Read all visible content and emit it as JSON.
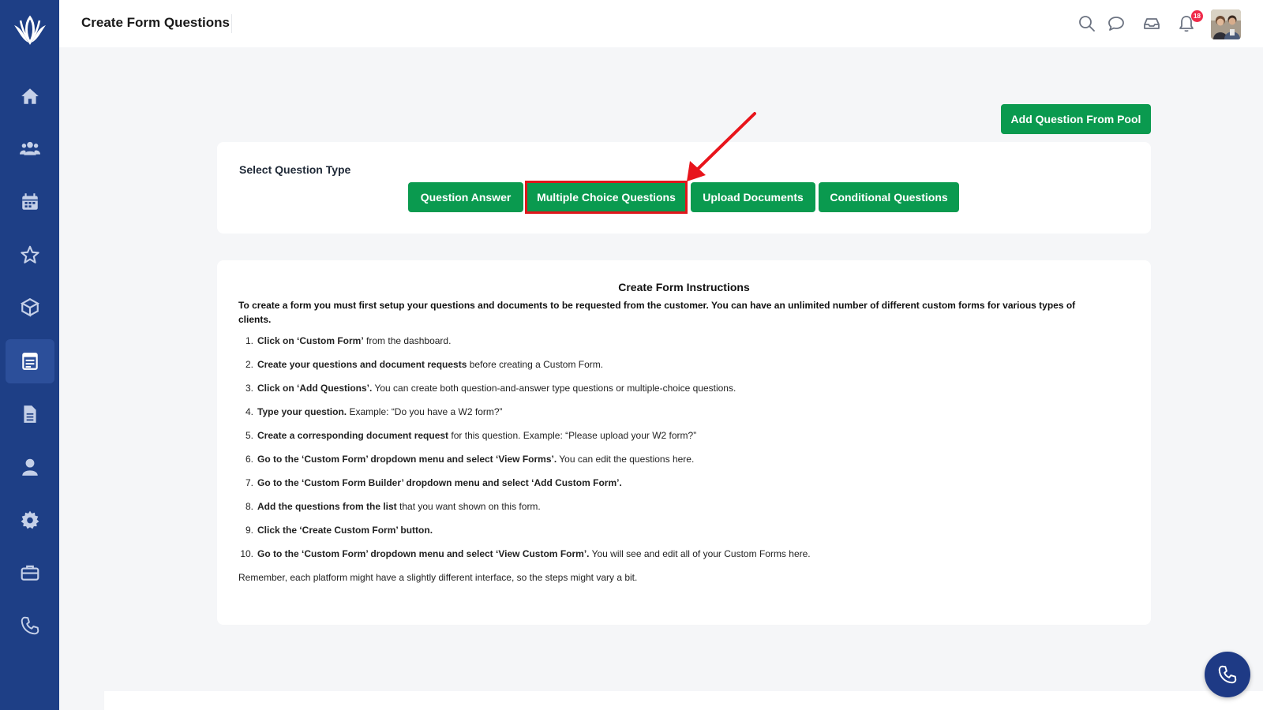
{
  "header": {
    "title": "Create Form Questions",
    "notification_count": "18"
  },
  "sidebar": {
    "items": [
      {
        "icon": "home-icon"
      },
      {
        "icon": "users-icon"
      },
      {
        "icon": "calendar-icon"
      },
      {
        "icon": "star-icon"
      },
      {
        "icon": "box-icon"
      },
      {
        "icon": "form-icon",
        "active": true
      },
      {
        "icon": "document-icon"
      },
      {
        "icon": "user-icon"
      },
      {
        "icon": "gear-icon"
      },
      {
        "icon": "briefcase-icon"
      },
      {
        "icon": "phone-icon"
      }
    ]
  },
  "actions": {
    "add_pool_label": "Add Question From Pool"
  },
  "question_type": {
    "label": "Select Question Type",
    "buttons": [
      "Question Answer",
      "Multiple Choice Questions",
      "Upload Documents",
      "Conditional Questions"
    ],
    "highlighted": "Multiple Choice Questions"
  },
  "instructions": {
    "title": "Create Form Instructions",
    "intro": "To create a form you must first setup your questions and documents to be requested from the customer. You can have an unlimited number of different custom forms for various types of clients.",
    "steps": [
      {
        "num": "1.",
        "bold": "Click on ‘Custom Form’",
        "rest": " from the dashboard."
      },
      {
        "num": "2.",
        "bold": "Create your questions and document requests",
        "rest": " before creating a Custom Form."
      },
      {
        "num": "3.",
        "bold": "Click on ‘Add Questions’.",
        "rest": " You can create both question-and-answer type questions or multiple-choice questions."
      },
      {
        "num": "4.",
        "bold": "Type your question.",
        "rest": " Example: “Do you have a W2 form?”"
      },
      {
        "num": "5.",
        "bold": "Create a corresponding document request",
        "rest": " for this question. Example: “Please upload your W2 form?”"
      },
      {
        "num": "6.",
        "bold": "Go to the ‘Custom Form’ dropdown menu and select ‘View Forms’.",
        "rest": " You can edit the questions here."
      },
      {
        "num": "7.",
        "bold": "Go to the ‘Custom Form Builder’ dropdown menu and select ‘Add Custom Form’.",
        "rest": ""
      },
      {
        "num": "8.",
        "bold": "Add the questions from the list",
        "rest": " that you want shown on this form."
      },
      {
        "num": "9.",
        "bold": "Click the ‘Create Custom Form’ button.",
        "rest": ""
      },
      {
        "num": "10.",
        "bold": "Go to the ‘Custom Form’ dropdown menu and select ‘View Custom Form’.",
        "rest": " You will see and edit all of your Custom Forms here."
      }
    ],
    "footer": "Remember, each platform might have a slightly different interface, so the steps might vary a bit."
  },
  "colors": {
    "sidebar": "#1e3f86",
    "accent_green": "#0a9a4f",
    "highlight_red": "#e0161b",
    "badge_red": "#ef2b4a"
  }
}
